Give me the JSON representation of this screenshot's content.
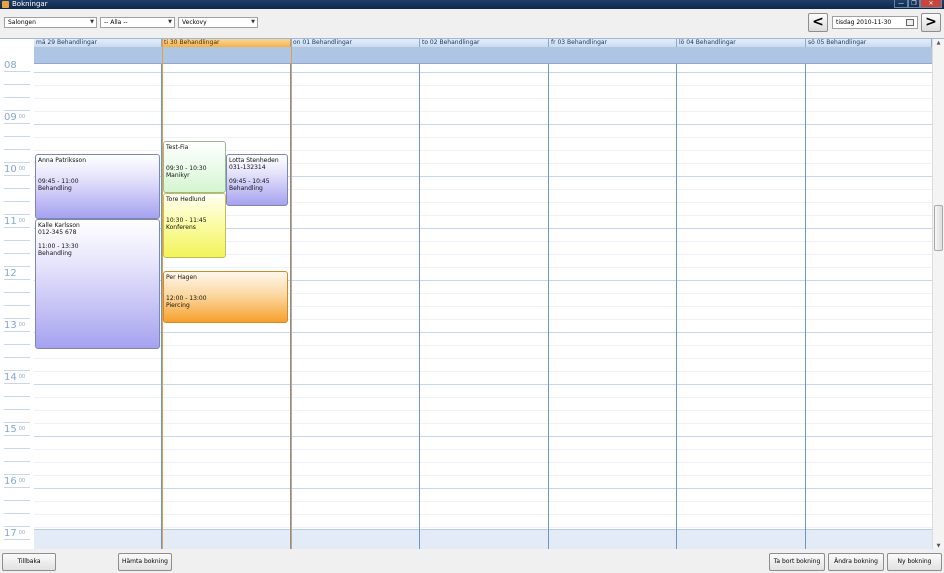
{
  "window": {
    "title": "Bokningar",
    "min": "—",
    "max": "❐",
    "close": "✕"
  },
  "toolbar": {
    "location": "Salongen",
    "staff": "-- Alla --",
    "view": "Veckovy",
    "prev": "<",
    "next": ">",
    "date": "tisdag  2010-11-30"
  },
  "days": [
    {
      "label": "må 29 Behandlingar"
    },
    {
      "label": "ti 30 Behandlingar"
    },
    {
      "label": "on 01 Behandlingar"
    },
    {
      "label": "to 02 Behandlingar"
    },
    {
      "label": "fr 03 Behandlingar"
    },
    {
      "label": "lö 04 Behandlingar"
    },
    {
      "label": "sö 05 Behandlingar"
    }
  ],
  "hours": [
    {
      "h": "08",
      "m": ""
    },
    {
      "h": "09",
      "m": "00"
    },
    {
      "h": "10",
      "m": "00"
    },
    {
      "h": "11",
      "m": "00"
    },
    {
      "h": "12",
      "m": ""
    },
    {
      "h": "13",
      "m": "00"
    },
    {
      "h": "14",
      "m": "00"
    },
    {
      "h": "15",
      "m": "00"
    },
    {
      "h": "16",
      "m": "00"
    },
    {
      "h": "17",
      "m": "00"
    }
  ],
  "appointments": [
    {
      "name": "Anna Patriksson",
      "phone": "",
      "time": "09:45 - 11:00",
      "type": "Behandling"
    },
    {
      "name": "Kalle Karlsson",
      "phone": "012-345 678",
      "time": "11:00 - 13:30",
      "type": "Behandling"
    },
    {
      "name": "Test-Fia",
      "phone": "",
      "time": "09:30 - 10:30",
      "type": "Manikyr"
    },
    {
      "name": "Lotta Stenheden",
      "phone": "031-132314",
      "time": "09:45 - 10:45",
      "type": "Behandling"
    },
    {
      "name": "Tore Hedlund",
      "phone": "",
      "time": "10:30 - 11:45",
      "type": "Konferens"
    },
    {
      "name": "Per Hagen",
      "phone": "",
      "time": "12:00 - 13:00",
      "type": "Piercing"
    }
  ],
  "bottom": {
    "back": "Tillbaka",
    "fetch": "Hämta bokning",
    "delete": "Ta bort bokning",
    "edit": "Ändra bokning",
    "new": "Ny bokning"
  },
  "colors": {
    "today_accent": "#e0a04a",
    "day_divider": "#6e95c7",
    "allday_band": "#aec6e4"
  }
}
